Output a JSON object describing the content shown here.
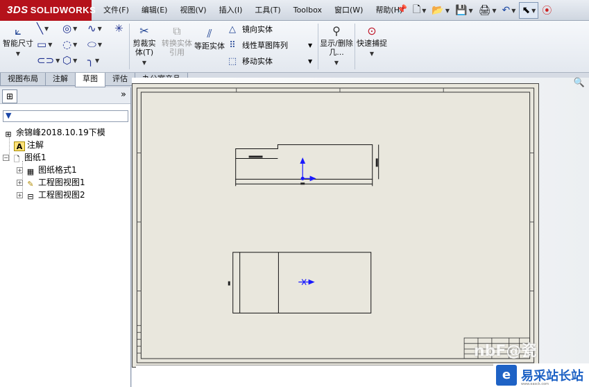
{
  "app": {
    "logo_text": "SOLIDWORKS",
    "logo_mark": "3DS"
  },
  "menu": [
    "文件(F)",
    "编辑(E)",
    "视图(V)",
    "插入(I)",
    "工具(T)",
    "Toolbox",
    "窗口(W)",
    "帮助(H)"
  ],
  "quick_access": [
    "new-document-icon",
    "open-folder-icon",
    "save-icon",
    "print-icon",
    "undo-icon",
    "select-arrow-icon",
    "traffic-light-icon"
  ],
  "commands": {
    "smart_dim": "智能尺寸",
    "trim": "剪裁实体(T)",
    "convert": "转换实体引用",
    "offset": "等距实体",
    "mirror": "镜向实体",
    "linear_pattern": "线性草图阵列",
    "move": "移动实体",
    "show_delete": "显示/删除几...",
    "quick_snap": "快速捕捉"
  },
  "tabs": [
    "视图布局",
    "注解",
    "草图",
    "评估",
    "办公室产品"
  ],
  "active_tab": "草图",
  "tree": {
    "root": "余锦峰2018.10.19下模",
    "annotations": "注解",
    "sheet": "图纸1",
    "sheet_format": "图纸格式1",
    "view1": "工程图视图1",
    "view2": "工程图视图2"
  },
  "watermark": {
    "brand": "易采站长站",
    "sub": "www.easck.com",
    "jingyan": "nbF@瓷"
  },
  "colors": {
    "logo_red": "#b5121b",
    "accent_blue": "#1b3f91",
    "sheet_bg": "#e9e7dd"
  }
}
